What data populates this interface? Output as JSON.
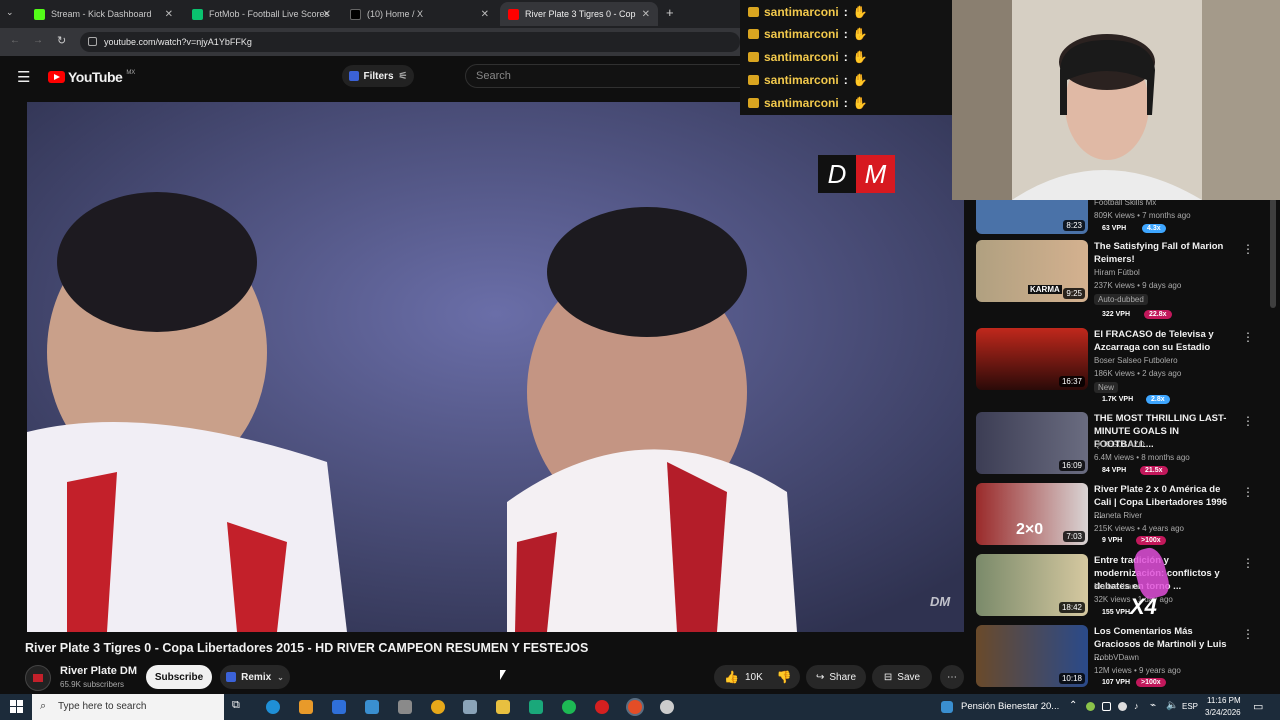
{
  "browser": {
    "tabs": [
      {
        "label": "Stream - Kick Dashboard",
        "color": "#53fc18"
      },
      {
        "label": "FotMob - Football Live Scores",
        "color": "#0ac26f"
      },
      {
        "label": "(10) Home / X",
        "color": "#ffffff"
      },
      {
        "label": "River Plate 3 Tigres 0 - Cop",
        "color": "#ff0000"
      }
    ],
    "url": "youtube.com/watch?v=njyA1YbFFKg"
  },
  "youtube": {
    "logo": "YouTube",
    "region": "MX",
    "filters_label": "Filters",
    "search_placeholder": "Search"
  },
  "video": {
    "title": "River Plate 3 Tigres 0 - Copa Libertadores 2015 - HD RIVER CAMPEON RESUMEN Y FESTEJOS",
    "watermark": "DM",
    "channel": "River Plate DM",
    "subscribers": "65.9K subscribers",
    "subscribe_label": "Subscribe",
    "remix_label": "Remix",
    "likes": "10K",
    "share_label": "Share",
    "save_label": "Save"
  },
  "sidebar": {
    "recs": [
      {
        "title": "",
        "channel": "Football Skills Mx",
        "meta": "809K views • 7 months ago",
        "duration": "8:23",
        "vph": "63 VPH",
        "pill": "4.3x",
        "pill_color": "#3ea6ff"
      },
      {
        "title": "The Satisfying Fall of Marion Reimers!",
        "channel": "Hiram Fútbol",
        "meta": "237K views • 9 days ago",
        "extra": "Auto-dubbed",
        "duration": "9:25",
        "vph": "322 VPH",
        "pill": "22.8x",
        "pill_color": "#c2185b"
      },
      {
        "title": "El FRACASO de Televisa y Azcarraga con su Estadio",
        "channel": "Boser Salseo Futbolero",
        "meta": "186K views • 2 days ago",
        "extra": "New",
        "duration": "16:37",
        "vph": "1.7K VPH",
        "pill": "2.8x",
        "pill_color": "#3ea6ff"
      },
      {
        "title": "THE MOST THRILLING LAST-MINUTE GOALS IN FOOTBALL...",
        "channel": "QUEGOLAZO",
        "meta": "84 VPH",
        "meta2": "6.4M views • 8 months ago",
        "duration": "16:09",
        "vph": "84 VPH",
        "pill": "21.5x",
        "pill_color": "#c2185b"
      },
      {
        "title": "River Plate 2 x 0 América de Cali | Copa Libertadores 1996 ...",
        "channel": "Planeta River",
        "meta": "215K views • 4 years ago",
        "duration": "7:03",
        "vph": "9 VPH",
        "pill": ">100x",
        "pill_color": "#c2185b"
      },
      {
        "title": "Entre tradición y modernización: conflictos y debates en torno ...",
        "channel": "Matías Ibarra",
        "meta": "32K views • 1 day ago",
        "duration": "18:42",
        "vph": "155 VPH",
        "pill": "",
        "pill_color": "#c2185b"
      },
      {
        "title": "Los Comentarios Más Graciosos de Martinoli y Luis ...",
        "channel": "RobbVDawn",
        "meta": "12M views • 9 years ago",
        "duration": "10:18",
        "vph": "107 VPH",
        "pill": ">100x",
        "pill_color": "#c2185b"
      }
    ]
  },
  "chat": {
    "lines": [
      {
        "user": "santimarconi",
        "sep": ":"
      },
      {
        "user": "santimarconi",
        "sep": ":"
      },
      {
        "user": "santimarconi",
        "sep": ":"
      },
      {
        "user": "santimarconi",
        "sep": ":"
      },
      {
        "user": "santimarconi",
        "sep": ":"
      }
    ],
    "emote_overlay": "X4"
  },
  "taskbar": {
    "search_placeholder": "Type here to search",
    "news": "Pensión Bienestar 20...",
    "lang": "ESP",
    "time": "11:16 PM",
    "date": "3/24/2026"
  }
}
